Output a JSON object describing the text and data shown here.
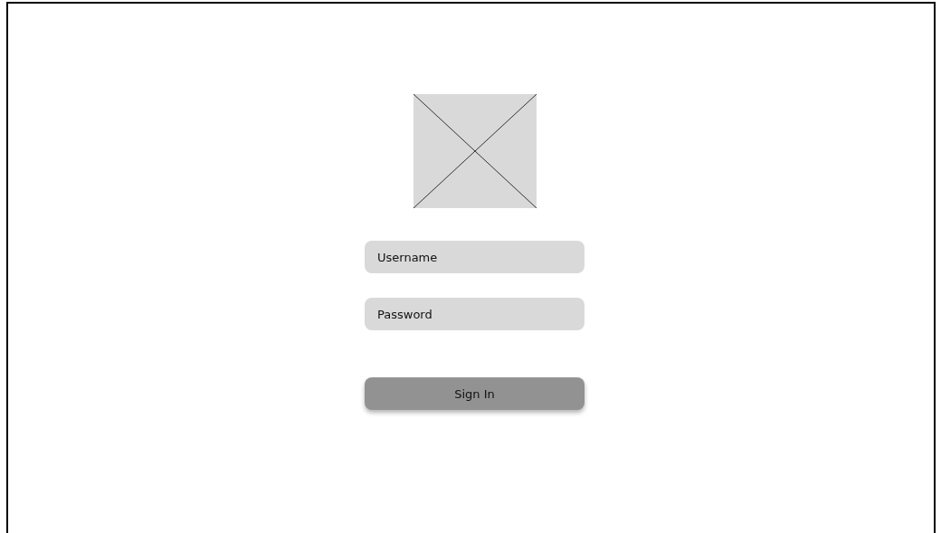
{
  "form": {
    "fields": [
      {
        "placeholder": "Username"
      },
      {
        "placeholder": "Password"
      }
    ],
    "button": "Sign In"
  }
}
